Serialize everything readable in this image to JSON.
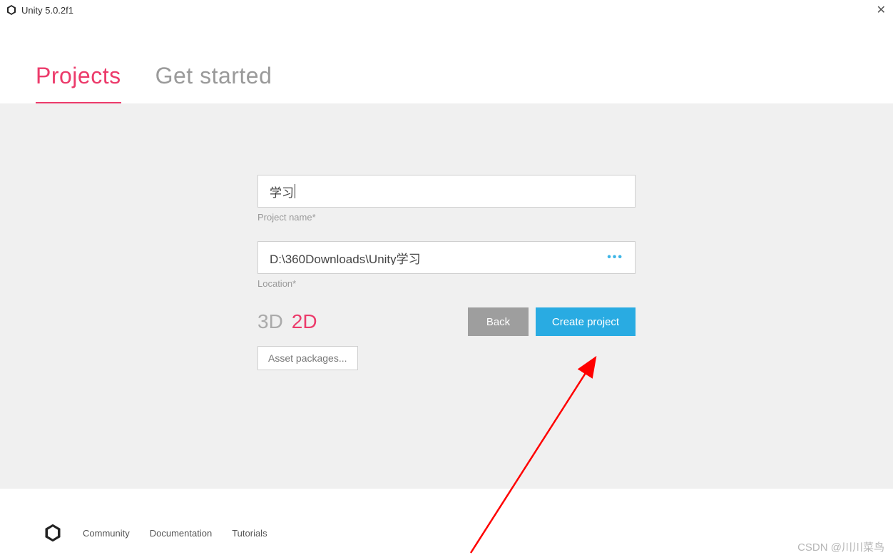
{
  "titlebar": {
    "title": "Unity 5.0.2f1"
  },
  "tabs": {
    "projects": "Projects",
    "get_started": "Get started"
  },
  "form": {
    "project_name_value": "学习",
    "project_name_label": "Project name*",
    "location_value": "D:\\360Downloads\\Unity学习",
    "location_label": "Location*",
    "mode_3d": "3D",
    "mode_2d": "2D",
    "back_button": "Back",
    "create_button": "Create project",
    "asset_packages": "Asset packages..."
  },
  "footer": {
    "community": "Community",
    "documentation": "Documentation",
    "tutorials": "Tutorials"
  },
  "watermark": "CSDN @川川菜鸟"
}
